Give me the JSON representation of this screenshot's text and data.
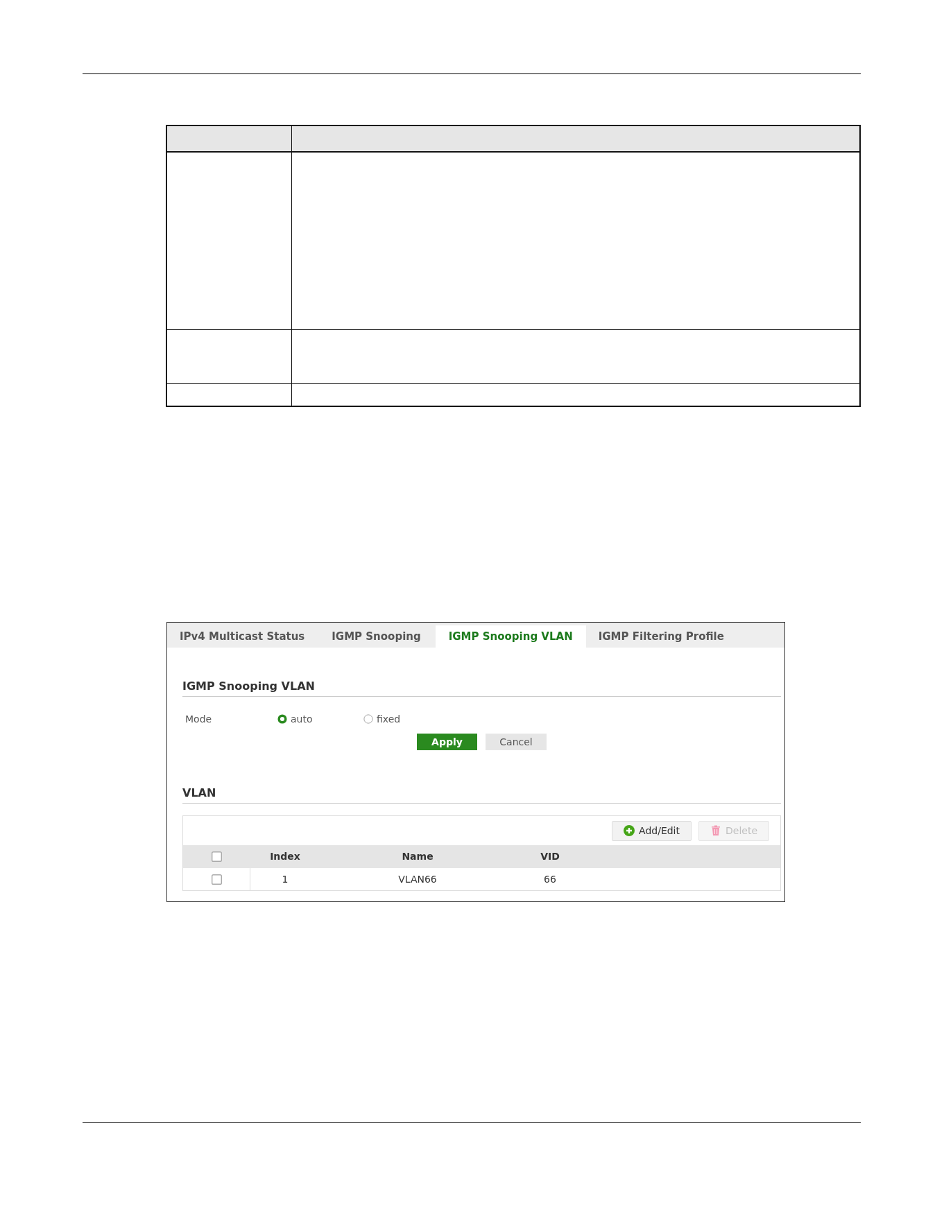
{
  "tabs": [
    {
      "label": "IPv4 Multicast Status",
      "selected": false
    },
    {
      "label": "IGMP Snooping",
      "selected": false
    },
    {
      "label": "IGMP Snooping VLAN",
      "selected": true
    },
    {
      "label": "IGMP Filtering Profile",
      "selected": false
    }
  ],
  "section": {
    "title": "IGMP Snooping VLAN"
  },
  "mode": {
    "label": "Mode",
    "options": [
      {
        "label": "auto",
        "selected": true
      },
      {
        "label": "fixed",
        "selected": false
      }
    ]
  },
  "buttons": [
    {
      "label": "Apply",
      "kind": "primary"
    },
    {
      "label": "Cancel",
      "kind": "secondary"
    }
  ],
  "vlan": {
    "title": "VLAN",
    "toolbar": [
      {
        "label": "Add/Edit",
        "kind": "add",
        "disabled": false
      },
      {
        "label": "Delete",
        "kind": "delete",
        "disabled": true
      }
    ],
    "table": {
      "select_all": {
        "checked": false
      },
      "columns": [
        "Index",
        "Name",
        "VID"
      ],
      "rows": [
        {
          "checked": false,
          "cells": [
            "1",
            "VLAN66",
            "66"
          ]
        }
      ]
    }
  }
}
